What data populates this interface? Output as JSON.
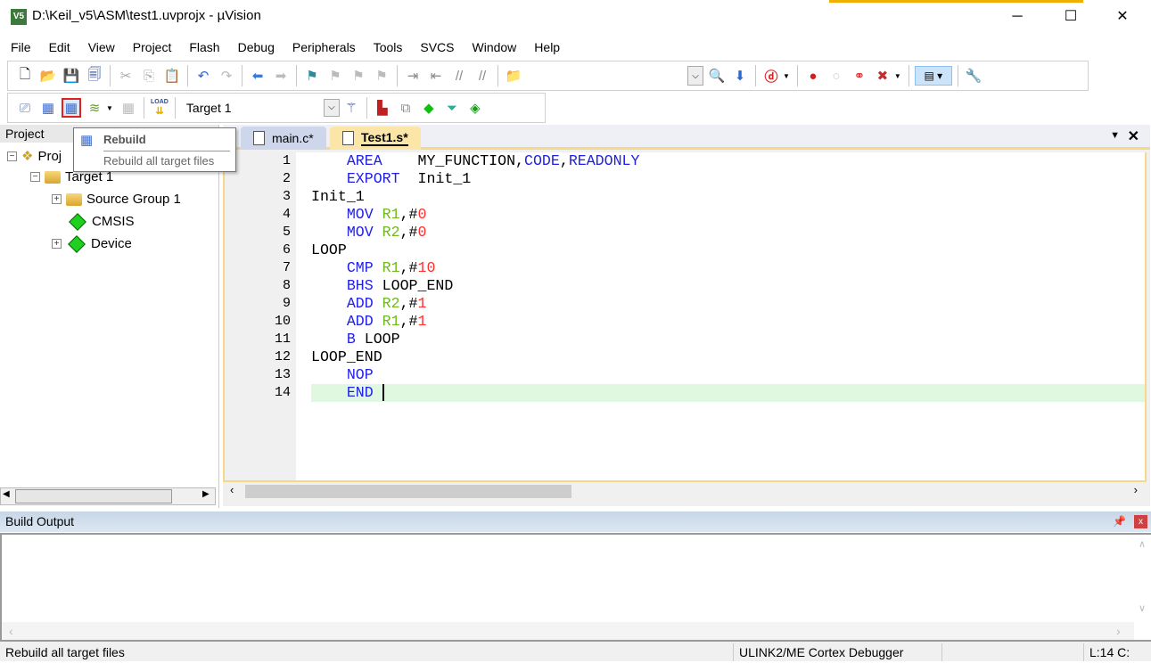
{
  "window": {
    "title": "D:\\Keil_v5\\ASM\\test1.uvprojx - µVision",
    "app_icon": "V5",
    "controls": [
      "─",
      "☐",
      "✕"
    ]
  },
  "menu": [
    "File",
    "Edit",
    "View",
    "Project",
    "Flash",
    "Debug",
    "Peripherals",
    "Tools",
    "SVCS",
    "Window",
    "Help"
  ],
  "toolbar2": {
    "target": "Target 1",
    "load_label": "LOAD"
  },
  "project": {
    "header": "Project",
    "tree": [
      {
        "label": "Proj",
        "icon": "project-icon"
      },
      {
        "label": "Target 1",
        "icon": "target-folder-icon"
      },
      {
        "label": "Source Group 1",
        "icon": "folder-icon"
      },
      {
        "label": "CMSIS",
        "icon": "component-icon"
      },
      {
        "label": "Device",
        "icon": "component-icon"
      }
    ]
  },
  "tooltip": {
    "title": "Rebuild",
    "description": "Rebuild all target files"
  },
  "editor": {
    "tabs": [
      {
        "label": "main.c*",
        "active": false
      },
      {
        "label": "Test1.s*",
        "active": true
      }
    ],
    "current_line": 14,
    "lines": [
      [
        [
          "kw",
          "    AREA    "
        ],
        [
          "txt",
          "MY_FUNCTION,"
        ],
        [
          "kw",
          "CODE"
        ],
        [
          "txt",
          ","
        ],
        [
          "kw",
          "READONLY"
        ]
      ],
      [
        [
          "kw",
          "    EXPORT  "
        ],
        [
          "txt",
          "Init_1"
        ]
      ],
      [
        [
          "txt",
          "Init_1"
        ]
      ],
      [
        [
          "kw",
          "    MOV "
        ],
        [
          "reg",
          "R1"
        ],
        [
          "txt",
          ",#"
        ],
        [
          "num",
          "0"
        ]
      ],
      [
        [
          "kw",
          "    MOV "
        ],
        [
          "reg",
          "R2"
        ],
        [
          "txt",
          ",#"
        ],
        [
          "num",
          "0"
        ]
      ],
      [
        [
          "txt",
          "LOOP"
        ]
      ],
      [
        [
          "kw",
          "    CMP "
        ],
        [
          "reg",
          "R1"
        ],
        [
          "txt",
          ",#"
        ],
        [
          "num",
          "10"
        ]
      ],
      [
        [
          "kw",
          "    BHS "
        ],
        [
          "txt",
          "LOOP_END"
        ]
      ],
      [
        [
          "kw",
          "    ADD "
        ],
        [
          "reg",
          "R2"
        ],
        [
          "txt",
          ",#"
        ],
        [
          "num",
          "1"
        ]
      ],
      [
        [
          "kw",
          "    ADD "
        ],
        [
          "reg",
          "R1"
        ],
        [
          "txt",
          ",#"
        ],
        [
          "num",
          "1"
        ]
      ],
      [
        [
          "kw",
          "    B "
        ],
        [
          "txt",
          "LOOP"
        ]
      ],
      [
        [
          "txt",
          "LOOP_END"
        ]
      ],
      [
        [
          "kw",
          "    NOP"
        ]
      ],
      [
        [
          "kw",
          "    END"
        ]
      ]
    ]
  },
  "build_output": {
    "title": "Build Output"
  },
  "status": {
    "message": "Rebuild all target files",
    "debugger": "ULINK2/ME Cortex Debugger",
    "position": "L:14 C:"
  },
  "colors": {
    "keyword": "#2020e8",
    "register": "#70b820",
    "number": "#ff3030",
    "current_line": "#e0f8e0",
    "tab_accent": "#f5d888"
  }
}
